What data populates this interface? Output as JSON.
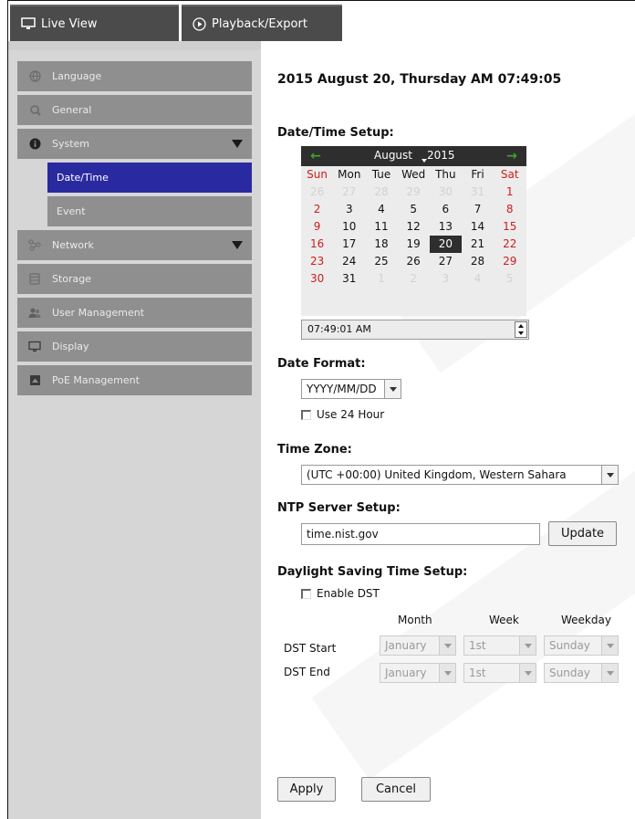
{
  "topbar": {
    "tabs": [
      {
        "label": "Live View",
        "icon": "monitor-icon"
      },
      {
        "label": "Playback/Export",
        "icon": "play-circle-icon"
      }
    ]
  },
  "sidebar": {
    "items": [
      {
        "label": "Language",
        "icon": "globe-icon"
      },
      {
        "label": "General",
        "icon": "wrench-icon"
      },
      {
        "label": "System",
        "icon": "info-icon",
        "expanded": true
      },
      {
        "label": "Date/Time",
        "sub": true,
        "active": true
      },
      {
        "label": "Event",
        "sub": true
      },
      {
        "label": "Network",
        "icon": "network-icon",
        "expanded": true
      },
      {
        "label": "Storage",
        "icon": "storage-icon"
      },
      {
        "label": "User Management",
        "icon": "users-icon"
      },
      {
        "label": "Display",
        "icon": "monitor-icon"
      },
      {
        "label": "PoE Management",
        "icon": "poe-icon"
      }
    ]
  },
  "main": {
    "current_datetime": "2015 August 20, Thursday AM 07:49:05",
    "datetime_setup": {
      "title": "Date/Time Setup:",
      "calendar": {
        "month": "August",
        "year": "2015",
        "weekdays": [
          "Sun",
          "Mon",
          "Tue",
          "Wed",
          "Thu",
          "Fri",
          "Sat"
        ],
        "weeks": [
          [
            "26",
            "27",
            "28",
            "29",
            "30",
            "31",
            "1"
          ],
          [
            "2",
            "3",
            "4",
            "5",
            "6",
            "7",
            "8"
          ],
          [
            "9",
            "10",
            "11",
            "12",
            "13",
            "14",
            "15"
          ],
          [
            "16",
            "17",
            "18",
            "19",
            "20",
            "21",
            "22"
          ],
          [
            "23",
            "24",
            "25",
            "26",
            "27",
            "28",
            "29"
          ],
          [
            "30",
            "31",
            "1",
            "2",
            "3",
            "4",
            "5"
          ]
        ],
        "selected_day": "20"
      },
      "time_value": "07:49:01 AM"
    },
    "date_format": {
      "title": "Date Format:",
      "value": "YYYY/MM/DD",
      "use24_label": "Use 24 Hour",
      "use24_checked": false
    },
    "time_zone": {
      "title": "Time Zone:",
      "value": "(UTC +00:00) United Kingdom, Western Sahara"
    },
    "ntp": {
      "title": "NTP Server Setup:",
      "value": "time.nist.gov",
      "update_label": "Update"
    },
    "dst": {
      "title": "Daylight Saving Time Setup:",
      "enable_label": "Enable DST",
      "enable_checked": false,
      "headers": [
        "Month",
        "Week",
        "Weekday"
      ],
      "start_label": "DST Start",
      "end_label": "DST End",
      "start": {
        "month": "January",
        "week": "1st",
        "weekday": "Sunday"
      },
      "end": {
        "month": "January",
        "week": "1st",
        "weekday": "Sunday"
      }
    },
    "actions": {
      "apply_label": "Apply",
      "cancel_label": "Cancel"
    }
  },
  "colors": {
    "sidebar_item": "#8f8f8f",
    "sidebar_active": "#2a2aa0",
    "weekend_red": "#d01c1c",
    "calendar_header": "#2e2e2e",
    "nav_arrow_green": "#3fa52c"
  }
}
